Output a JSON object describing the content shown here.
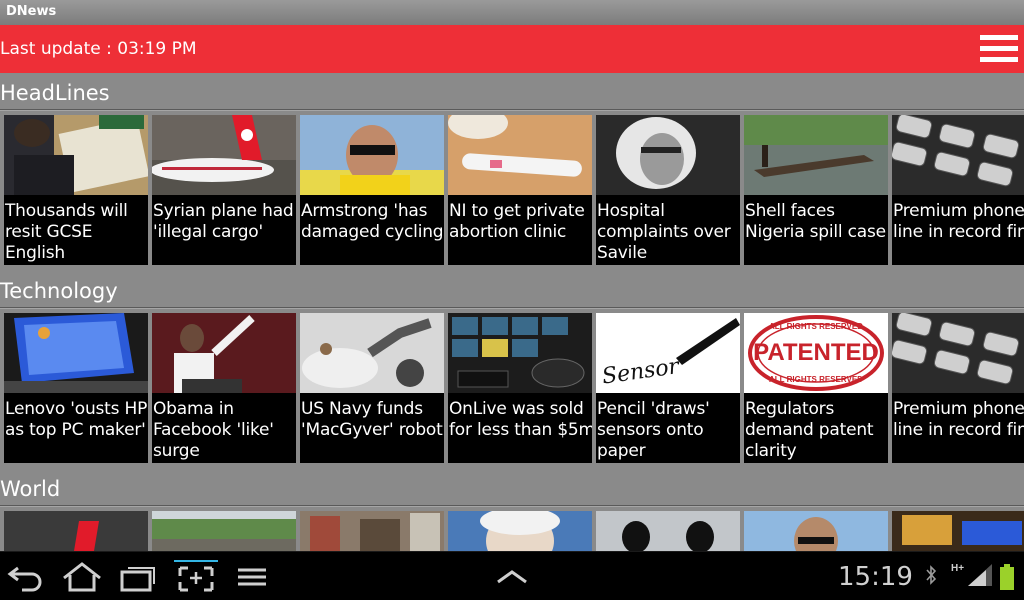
{
  "app": {
    "title": "DNews"
  },
  "header": {
    "last_update": "Last update : 03:19 PM",
    "menu_icon": "hamburger-menu-icon",
    "accent": "#ee2f37"
  },
  "sections": [
    {
      "title": "HeadLines",
      "items": [
        {
          "caption": "Thousands will resit GCSE English"
        },
        {
          "caption": "Syrian plane had 'illegal cargo'"
        },
        {
          "caption": "Armstrong 'has damaged cycling'"
        },
        {
          "caption": "NI to get private abortion clinic"
        },
        {
          "caption": "Hospital complaints over Savile"
        },
        {
          "caption": "Shell faces Nigeria spill case"
        },
        {
          "caption": "Premium phone line in record fine"
        }
      ]
    },
    {
      "title": "Technology",
      "items": [
        {
          "caption": "Lenovo 'ousts HP as top PC maker'"
        },
        {
          "caption": "Obama in Facebook 'like' surge"
        },
        {
          "caption": "US Navy funds 'MacGyver' robot"
        },
        {
          "caption": "OnLive was sold for less than $5m"
        },
        {
          "caption": "Pencil 'draws' sensors onto paper"
        },
        {
          "caption": "Regulators demand patent clarity"
        },
        {
          "caption": "Premium phone line in record fine"
        }
      ]
    },
    {
      "title": "World"
    }
  ],
  "patent_stamp": {
    "top": "ALL RIGHTS RESERVED",
    "main": "PATENTED",
    "bottom": "ALL RIGHTS RESERVED"
  },
  "sensor_script": "Sensor",
  "status_bar": {
    "time": "15:19",
    "network": "H+"
  }
}
